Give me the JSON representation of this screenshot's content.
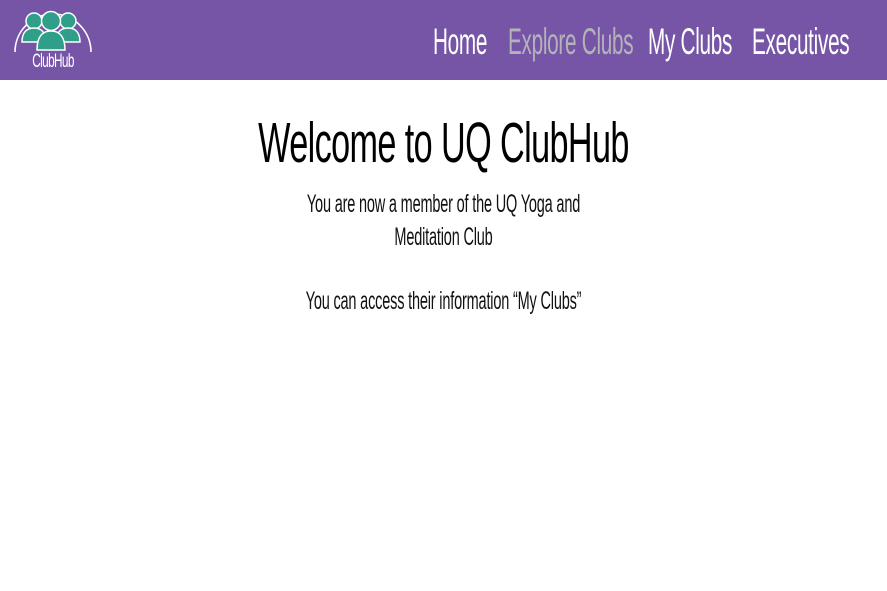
{
  "brand": {
    "name": "ClubHub",
    "colors": {
      "navbar": "#7655a6",
      "logo_figures": "#2f9f8a",
      "nav_active": "#b3b3b9"
    }
  },
  "nav": {
    "items": [
      {
        "label": "Home"
      },
      {
        "label": "Explore Clubs"
      },
      {
        "label": "My Clubs"
      },
      {
        "label": "Executives"
      }
    ],
    "active_index": 1
  },
  "main": {
    "title": "Welcome to UQ ClubHub",
    "message_line1": "You are now a member of the UQ Yoga and",
    "message_line2": "Meditation Club",
    "access_text": "You can access their information “My Clubs”"
  }
}
